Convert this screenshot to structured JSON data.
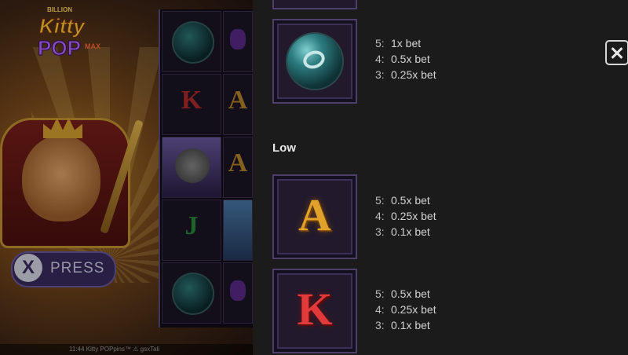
{
  "game": {
    "logo": {
      "line1": "BILLION",
      "line2": "Kitty",
      "line3": "POP",
      "line4": "MAX"
    },
    "xpress_button": {
      "icon": "X",
      "label": "PRESS"
    },
    "status_bar": "11:44  Kitty POPpins™  ⚠  gsxTali"
  },
  "paytable": {
    "section_low": "Low",
    "symbols": [
      {
        "icon": "orb-ring-icon",
        "pays": [
          {
            "count": "5:",
            "value": "1x bet"
          },
          {
            "count": "4:",
            "value": "0.5x bet"
          },
          {
            "count": "3:",
            "value": "0.25x bet"
          }
        ]
      },
      {
        "icon": "letter-a-icon",
        "glyph": "A",
        "pays": [
          {
            "count": "5:",
            "value": "0.5x bet"
          },
          {
            "count": "4:",
            "value": "0.25x bet"
          },
          {
            "count": "3:",
            "value": "0.1x bet"
          }
        ]
      },
      {
        "icon": "letter-k-icon",
        "glyph": "K",
        "pays": [
          {
            "count": "5:",
            "value": "0.5x bet"
          },
          {
            "count": "4:",
            "value": "0.25x bet"
          },
          {
            "count": "3:",
            "value": "0.1x bet"
          }
        ]
      }
    ]
  },
  "close_icon": "close-icon",
  "reels": {
    "glyph_k": "K",
    "glyph_a": "A",
    "glyph_j": "J"
  },
  "colors": {
    "panel_bg": "#1b1b1b",
    "frame": "#4e3f6a",
    "gold": "#e0a22a",
    "red": "#e03a3a"
  }
}
